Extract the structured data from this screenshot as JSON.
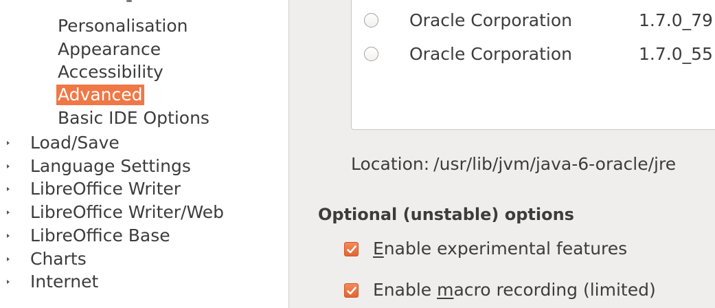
{
  "tree": {
    "children": [
      {
        "label": "Personalisation"
      },
      {
        "label": "Appearance"
      },
      {
        "label": "Accessibility"
      },
      {
        "label": "Advanced",
        "selected": true
      },
      {
        "label": "Basic IDE Options"
      }
    ],
    "parents": [
      {
        "label": "Load/Save"
      },
      {
        "label": "Language Settings"
      },
      {
        "label": "LibreOffice Writer"
      },
      {
        "label": "LibreOffice Writer/Web"
      },
      {
        "label": "LibreOffice Base"
      },
      {
        "label": "Charts"
      },
      {
        "label": "Internet"
      }
    ]
  },
  "jre_list": {
    "rows": [
      {
        "vendor": "Oracle Corporation",
        "version": "1.7.0_79",
        "selected": false
      },
      {
        "vendor": "Oracle Corporation",
        "version": "1.7.0_55",
        "selected": false
      }
    ]
  },
  "location": {
    "label": "Location:",
    "path": "/usr/lib/jvm/java-6-oracle/jre"
  },
  "optional": {
    "heading": "Optional (unstable) options",
    "options": [
      {
        "pre": "",
        "mnemonic": "E",
        "post": "nable experimental features",
        "checked": true
      },
      {
        "pre": "Enable ",
        "mnemonic": "m",
        "post": "acro recording (limited)",
        "checked": true
      }
    ]
  },
  "colors": {
    "accent": "#f07746",
    "pane_bg": "#efeeed",
    "text": "#3c3c3c"
  }
}
